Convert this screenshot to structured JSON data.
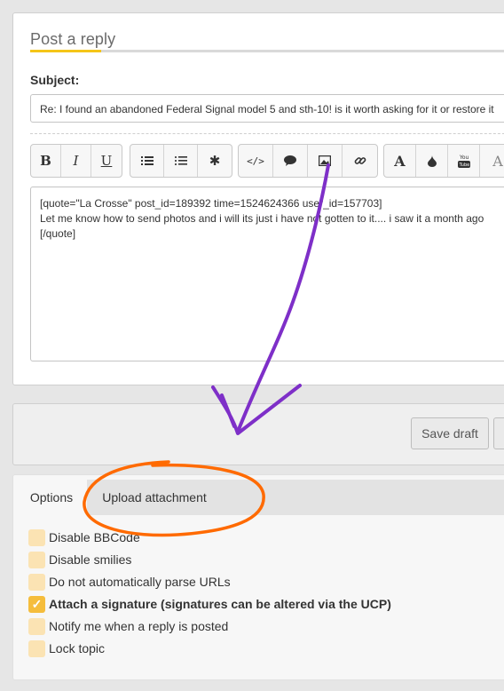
{
  "reply": {
    "title": "Post a reply",
    "subject_label": "Subject:",
    "subject_value": "Re: I found an abandoned Federal Signal model 5 and sth-10! is it worth asking for it or restore it"
  },
  "toolbar": {
    "groups": [
      [
        {
          "icon": "bold-icon",
          "glyph": "B"
        },
        {
          "icon": "italic-icon",
          "glyph": "I"
        },
        {
          "icon": "underline-icon",
          "glyph": "U"
        }
      ],
      [
        {
          "icon": "bullet-list-icon",
          "glyph": "☰"
        },
        {
          "icon": "numbered-list-icon",
          "glyph": "⋮☰"
        },
        {
          "icon": "asterisk-icon",
          "glyph": "✱"
        }
      ],
      [
        {
          "icon": "code-icon",
          "glyph": "</>"
        },
        {
          "icon": "quote-bubble-icon",
          "glyph": "●"
        },
        {
          "icon": "image-icon",
          "glyph": "▣"
        },
        {
          "icon": "link-icon",
          "glyph": "∞"
        }
      ],
      [
        {
          "icon": "font-size-icon",
          "glyph": "A"
        },
        {
          "icon": "color-drop-icon",
          "glyph": "♦"
        },
        {
          "icon": "youtube-icon",
          "glyph": "▶"
        },
        {
          "icon": "font-icon",
          "glyph": "A"
        }
      ]
    ]
  },
  "message": {
    "line1": "[quote=\"La Crosse\" post_id=189392 time=1524624366 user_id=157703]",
    "line2": "Let me know how to send photos and i will its just i have not gotten to it.... i saw it a month ago",
    "line3": "[/quote]"
  },
  "actions": {
    "save_draft": "Save draft"
  },
  "tabs": {
    "options": "Options",
    "upload": "Upload attachment"
  },
  "options": [
    {
      "label": "Disable BBCode",
      "checked": false,
      "bold": false
    },
    {
      "label": "Disable smilies",
      "checked": false,
      "bold": false
    },
    {
      "label": "Do not automatically parse URLs",
      "checked": false,
      "bold": false
    },
    {
      "label": "Attach a signature (signatures can be altered via the UCP)",
      "checked": true,
      "bold": true
    },
    {
      "label": "Notify me when a reply is posted",
      "checked": false,
      "bold": false
    },
    {
      "label": "Lock topic",
      "checked": false,
      "bold": false
    }
  ],
  "colors": {
    "accent_underline": "#f5c518",
    "checkbox": "#fbe3b3",
    "checkbox_checked": "#f5bd3c",
    "annotation_arrow": "#7e2fc8",
    "annotation_circle": "#ff6a00"
  }
}
